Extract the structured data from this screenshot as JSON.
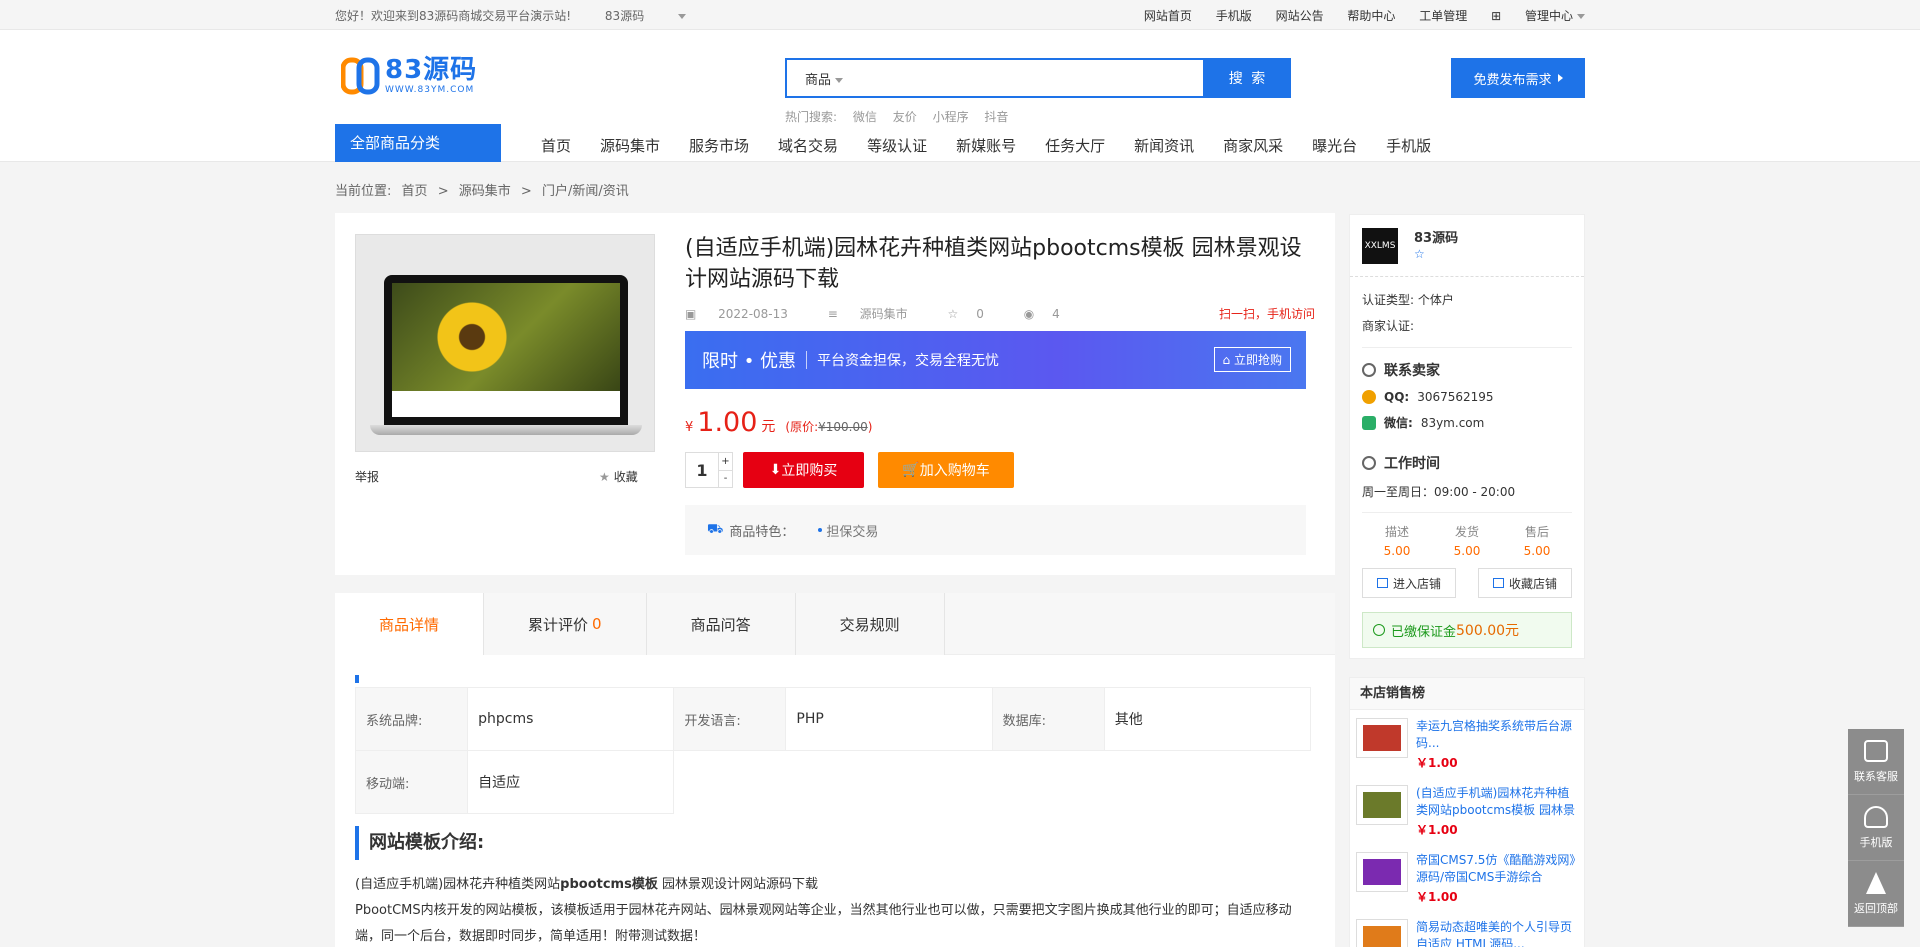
{
  "topbar": {
    "welcome": "您好！欢迎来到83源码商城交易平台演示站!",
    "site_select": "83源码",
    "links": [
      "网站首页",
      "手机版",
      "网站公告",
      "帮助中心",
      "工单管理"
    ],
    "manage": "管理中心"
  },
  "header": {
    "logo_main": "83源码",
    "logo_sub": "WWW.83YM.COM",
    "search_type": "商品",
    "search_value": "",
    "search_button": "搜 索",
    "hot_label": "热门搜索:",
    "hot_terms": [
      "微信",
      "友价",
      "小程序",
      "抖音"
    ],
    "publish_button": "免费发布需求",
    "category_label": "全部商品分类",
    "nav": [
      "首页",
      "源码集市",
      "服务市场",
      "域名交易",
      "等级认证",
      "新媒账号",
      "任务大厅",
      "新闻资讯",
      "商家风采",
      "曝光台",
      "手机版"
    ]
  },
  "breadcrumb": [
    "当前位置:",
    "首页",
    ">",
    "源码集市",
    ">",
    "门户/新闻/资讯"
  ],
  "product": {
    "title": "(自适应手机端)园林花卉种植类网站pbootcms模板 园林景观设计网站源码下载",
    "date": "2022-08-13",
    "category": "源码集市",
    "favorites": "0",
    "views": "4",
    "scan": "扫一扫，手机访问",
    "report": "举报",
    "collect": "收藏",
    "promo_title": "限时 • 优惠",
    "promo_text": "平台资金担保，交易全程无忧",
    "promo_button": "立即抢购",
    "currency": "¥",
    "price": "1.00",
    "price_unit": "元",
    "orig_label": "(原价:",
    "orig_price": "¥100.00",
    "orig_close": ")",
    "quantity": "1",
    "qty_plus": "+",
    "qty_minus": "-",
    "buy_button": "立即购买",
    "cart_button": "加入购物车",
    "feature_label": "商品特色：",
    "feature_tag": "担保交易"
  },
  "tabs": [
    {
      "label": "商品详情",
      "count": ""
    },
    {
      "label": "累计评价",
      "count": "0"
    },
    {
      "label": "商品问答",
      "count": ""
    },
    {
      "label": "交易规则",
      "count": ""
    }
  ],
  "spec": [
    [
      {
        "k": "系统品牌:",
        "v": "phpcms"
      },
      {
        "k": "开发语言:",
        "v": "PHP"
      },
      {
        "k": "数据库:",
        "v": "其他"
      }
    ],
    [
      {
        "k": "移动端:",
        "v": "自适应"
      }
    ]
  ],
  "intro": {
    "heading": "网站模板介绍:",
    "line1_a": "(自适应手机端)园林花卉种植类网站",
    "line1_b": "pbootcms模板",
    "line1_c": " 园林景观设计网站源码下载",
    "para": "PbootCMS内核开发的网站模板，该模板适用于园林花卉网站、园林景观网站等企业，当然其他行业也可以做，只需要把文字图片换成其他行业的即可；自适应移动端，同一个后台，数据即时同步，简单适用！附带测试数据！"
  },
  "shop": {
    "name": "83源码",
    "avatar_text": "XXLMS",
    "cert_type_label": "认证类型:",
    "cert_type": "个体户",
    "merchant_label": "商家认证:",
    "contact_title": "联系卖家",
    "qq_label": "QQ:",
    "qq": "3067562195",
    "wx_label": "微信:",
    "wx": "83ym.com",
    "hours_title": "工作时间",
    "hours": "周一至周日：09:00 - 20:00",
    "scores": [
      {
        "label": "描述",
        "score": "5.00"
      },
      {
        "label": "发货",
        "score": "5.00"
      },
      {
        "label": "售后",
        "score": "5.00"
      }
    ],
    "enter_button": "进入店铺",
    "collect_button": "收藏店铺",
    "deposit_label": "已缴保证金",
    "deposit_amount": "500.00元"
  },
  "rank": {
    "title": "本店销售榜",
    "items": [
      {
        "title": "幸运九宫格抽奖系统带后台源码...",
        "price": "￥1.00",
        "color": "#c0392b"
      },
      {
        "title": "(自适应手机端)园林花卉种植类网站pbootcms模板 园林景",
        "price": "￥1.00",
        "color": "#6b7a2a"
      },
      {
        "title": "帝国CMS7.5仿《酷酷游戏网》源码/帝国CMS手游综合",
        "price": "￥1.00",
        "color": "#7b2ab0"
      },
      {
        "title": "简易动态超唯美的个人引导页自适应 HTML源码...",
        "price": "",
        "color": "#e07b1a"
      }
    ]
  },
  "float": [
    "联系客服",
    "手机版",
    "返回顶部"
  ]
}
